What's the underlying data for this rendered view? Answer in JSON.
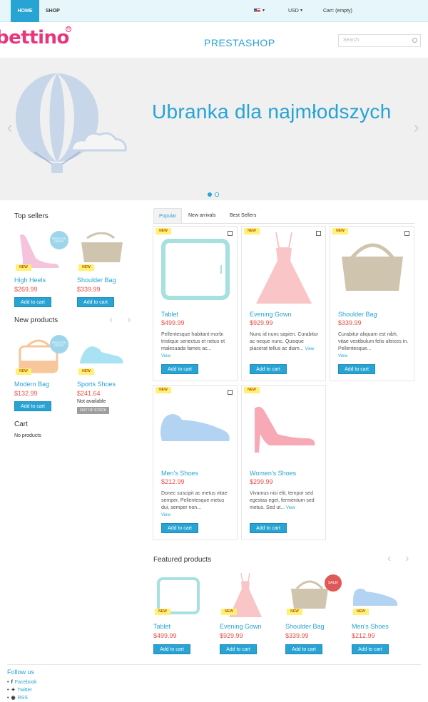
{
  "nav": {
    "home": "HOME",
    "shop": "SHOP",
    "currency": "USD",
    "cart": "Cart: (empty)",
    "caret": "▾"
  },
  "header": {
    "logo": "bettino",
    "store_name": "PRESTASHOP",
    "search_placeholder": "Search"
  },
  "slider": {
    "slogan": "Ubranka dla najmłodszych",
    "prev": "‹",
    "next": "›"
  },
  "top_sellers": {
    "title": "Top sellers",
    "items": [
      {
        "name": "High Heels",
        "price": "$269.99",
        "badge": "NEW",
        "flag": "REDUCED PRICE!",
        "button": "Add to cart"
      },
      {
        "name": "Shoulder Bag",
        "price": "$339.99",
        "badge": "NEW",
        "button": "Add to cart"
      }
    ]
  },
  "new_products": {
    "title": "New products",
    "prev": "‹",
    "next": "›",
    "items": [
      {
        "name": "Modern Bag",
        "price": "$132.99",
        "badge": "NEW",
        "flag": "REDUCED PRICE!",
        "button": "Add to cart"
      },
      {
        "name": "Sports Shoes",
        "price": "$241.64",
        "badge": "NEW",
        "availability": "Not available",
        "stock_label": "OUT OF STOCK"
      }
    ]
  },
  "cart_block": {
    "title": "Cart",
    "empty": "No products"
  },
  "tabs": [
    "Popular",
    "New arrivals",
    "Best Sellers"
  ],
  "products": [
    {
      "name": "Tablet",
      "price": "$499.99",
      "badge": "NEW",
      "desc": "Pellentesque habitant morbi tristique senectus et netus et malesuada fames ac...",
      "view": "View",
      "button": "Add to cart"
    },
    {
      "name": "Evening Gown",
      "price": "$929.99",
      "badge": "NEW",
      "desc": "Nunc id nunc sapien. Curabitur ac neque nunc. Quisque placerat tellus ac diam...",
      "view": "View",
      "button": "Add to cart"
    },
    {
      "name": "Shoulder Bag",
      "price": "$339.99",
      "badge": "NEW",
      "desc": "Curabitur aliquam est nibh, vitae vestibulum felis ultrices in. Pellentesque...",
      "view": "View",
      "button": "Add to cart"
    },
    {
      "name": "Men's Shoes",
      "price": "$212.99",
      "badge": "NEW",
      "desc": "Donec suscipit ac metus vitae semper. Pellentesque metus dui, semper non...",
      "view": "View",
      "button": "Add to cart"
    },
    {
      "name": "Women's Shoes",
      "price": "$299.99",
      "badge": "NEW",
      "desc": "Vivamus nisi elit, tempor sed egestas eget, fermentum sed metus. Sed ut...",
      "view": "View",
      "button": "Add to cart"
    }
  ],
  "featured": {
    "title": "Featured products",
    "prev": "‹",
    "next": "›",
    "items": [
      {
        "name": "Tablet",
        "price": "$499.99",
        "badge": "NEW",
        "button": "Add to cart"
      },
      {
        "name": "Evening Gown",
        "price": "$929.99",
        "badge": "NEW",
        "button": "Add to cart"
      },
      {
        "name": "Shoulder Bag",
        "price": "$339.99",
        "badge": "NEW",
        "sale": "SALE!",
        "button": "Add to cart"
      },
      {
        "name": "Men's Shoes",
        "price": "$212.99",
        "badge": "NEW",
        "button": "Add to cart"
      }
    ]
  },
  "follow": {
    "title": "Follow us",
    "links": [
      "Facebook",
      "Twitter",
      "RSS"
    ]
  },
  "colors": {
    "accent": "#27a3d4",
    "price": "#e8514a",
    "brand": "#e8357d"
  }
}
